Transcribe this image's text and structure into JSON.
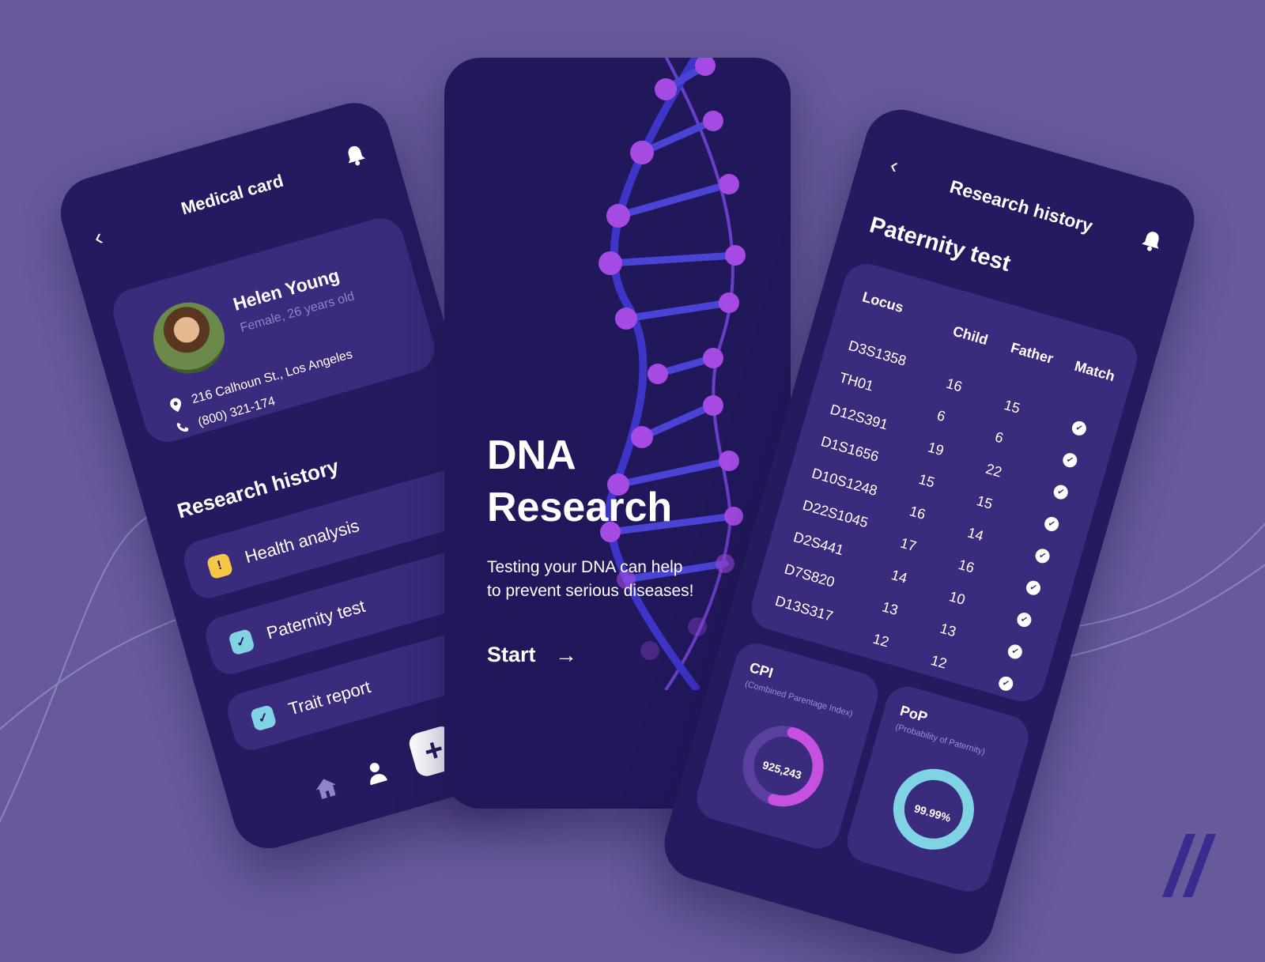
{
  "medical_card": {
    "title": "Medical card",
    "back_icon": "chevron-left-icon",
    "bell_icon": "bell-icon",
    "profile": {
      "name": "Helen Young",
      "subtitle": "Female, 26 years old",
      "address": "216 Calhoun St., Los Angeles",
      "phone": "(800) 321-174"
    },
    "research_history_title": "Research history",
    "items": [
      {
        "label": "Health analysis",
        "status": "warning",
        "chip": "!"
      },
      {
        "label": "Paternity test",
        "status": "done",
        "chip": "✓"
      },
      {
        "label": "Trait report",
        "status": "done",
        "chip": "✓"
      }
    ],
    "nav": {
      "add_label": "+"
    }
  },
  "dna_intro": {
    "title": "DNA\nResearch",
    "subtitle": "Testing your DNA can help\nto prevent serious diseases!",
    "start_label": "Start",
    "arrow": "→"
  },
  "research_history": {
    "title": "Research history",
    "heading": "Paternity test",
    "table": {
      "headers": [
        "Locus",
        "Child",
        "Father",
        "Match"
      ],
      "rows": [
        {
          "locus": "D3S1358",
          "child": "16",
          "father": "15"
        },
        {
          "locus": "TH01",
          "child": "6",
          "father": "6"
        },
        {
          "locus": "D12S391",
          "child": "19",
          "father": "22"
        },
        {
          "locus": "D1S1656",
          "child": "15",
          "father": "15"
        },
        {
          "locus": "D10S1248",
          "child": "16",
          "father": "14"
        },
        {
          "locus": "D22S1045",
          "child": "17",
          "father": "16"
        },
        {
          "locus": "D2S441",
          "child": "14",
          "father": "10"
        },
        {
          "locus": "D7S820",
          "child": "13",
          "father": "13"
        },
        {
          "locus": "D13S317",
          "child": "12",
          "father": "12"
        }
      ]
    },
    "cpi": {
      "title": "CPI",
      "subtitle": "(Combined Parentage Index)",
      "value": "925,243",
      "fill": 0.5
    },
    "pop": {
      "title": "PoP",
      "subtitle": "(Probability of Paternity)",
      "value": "99.99%",
      "fill": 0.9999
    }
  },
  "colors": {
    "background": "#67599a",
    "card": "#241a5f",
    "panel": "#3b2b7d",
    "cpi_ring": "#c650e0",
    "pop_ring": "#7fd3e2",
    "warning": "#f5c747",
    "check": "#7fd3e2"
  }
}
